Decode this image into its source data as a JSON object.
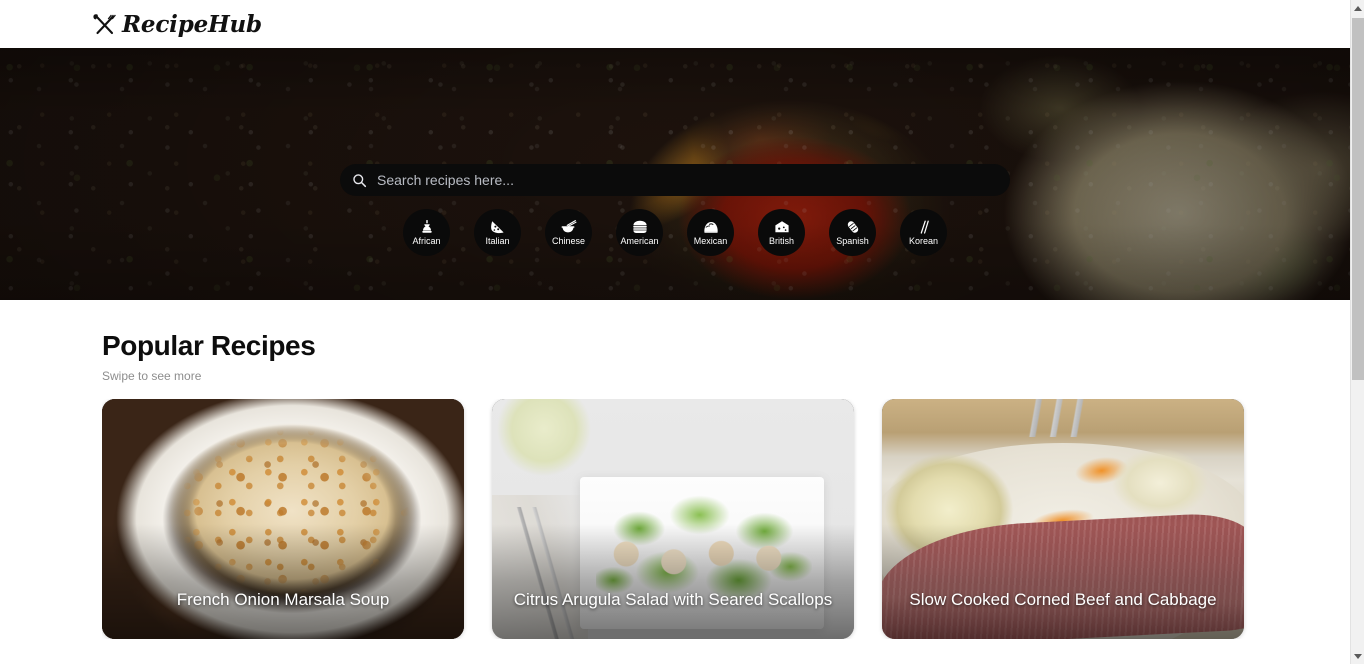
{
  "header": {
    "brand_name": "RecipeHub",
    "brand_icon": "fork-knife-cross-icon"
  },
  "hero": {
    "search": {
      "icon": "search-icon",
      "placeholder": "Search recipes here...",
      "value": ""
    },
    "categories": [
      {
        "label": "African",
        "icon": "mortar-pestle-icon"
      },
      {
        "label": "Italian",
        "icon": "pizza-slice-icon"
      },
      {
        "label": "Chinese",
        "icon": "noodle-bowl-chopsticks-icon"
      },
      {
        "label": "American",
        "icon": "burger-icon"
      },
      {
        "label": "Mexican",
        "icon": "taco-icon"
      },
      {
        "label": "British",
        "icon": "cheese-wedge-icon"
      },
      {
        "label": "Spanish",
        "icon": "burrito-icon"
      },
      {
        "label": "Korean",
        "icon": "chopsticks-icon"
      }
    ]
  },
  "popular": {
    "title": "Popular Recipes",
    "subtitle": "Swipe to see more",
    "cards": [
      {
        "title": "French Onion Marsala Soup"
      },
      {
        "title": "Citrus Arugula Salad with Seared Scallops"
      },
      {
        "title": "Slow Cooked Corned Beef and Cabbage"
      }
    ]
  },
  "colors": {
    "chip_background": "#0a0a0a",
    "search_background": "#0b0b0b",
    "page_background": "#ffffff",
    "title_text": "#0d0d0d",
    "subtitle_text": "#8d8d8d",
    "card_title_text": "#ffffff"
  }
}
